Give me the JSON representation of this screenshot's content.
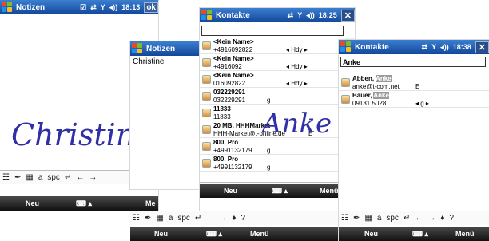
{
  "notes": {
    "title": "Notizen",
    "status": "18:13",
    "ok": "ok",
    "signature": "Christine",
    "kb": [
      "☷",
      "✒",
      "▦",
      "a",
      "spc",
      "↵",
      "←",
      "→"
    ],
    "softkeys": {
      "left": "Neu",
      "right": "Me"
    }
  },
  "notes_text": {
    "title": "Notizen",
    "text": "Christine"
  },
  "contacts": {
    "title": "Kontakte",
    "status": "18:25",
    "close": "✕",
    "search_value": "",
    "handwriting": "Anke",
    "rows": [
      {
        "name": "<Kein Name>",
        "detail": "+4916092822",
        "tag": "◂ Hdy ▸"
      },
      {
        "name": "<Kein Name>",
        "detail": "+4916092",
        "tag": "◂ Hdy ▸"
      },
      {
        "name": "<Kein Name>",
        "detail": "016092822",
        "tag": "◂ Hdy ▸"
      },
      {
        "name": "032229291",
        "detail": "032229291",
        "tag": "g"
      },
      {
        "name": "11833",
        "detail": "11833",
        "tag": ""
      },
      {
        "name": "20 MB, HHHMarket",
        "detail": "HHH-Market@t-online.de",
        "tag": "E"
      },
      {
        "name": "800, Pro",
        "detail": "+4991132179",
        "tag": "g"
      },
      {
        "name": "800, Pro",
        "detail": "+4991132179",
        "tag": "g"
      }
    ],
    "kb": [
      "☷",
      "✒",
      "▦",
      "a",
      "spc",
      "↵",
      "←",
      "→",
      "♦",
      "?"
    ],
    "softkeys": {
      "left": "Neu",
      "right": "Menü"
    }
  },
  "contacts2": {
    "title": "Kontakte",
    "status": "18:38",
    "close": "✕",
    "search_value": "Anke",
    "rows": [
      {
        "name_pre": "Abben, ",
        "name_hl": "Anke",
        "detail": "anke@t-com.net",
        "tag": "E"
      },
      {
        "name_pre": "Bauer, ",
        "name_hl": "Anke",
        "detail": "09131 5028",
        "tag": "◂ g ▸"
      }
    ],
    "kb": [
      "☷",
      "✒",
      "▦",
      "a",
      "spc",
      "↵",
      "←",
      "→",
      "♦",
      "?"
    ],
    "softkeys": {
      "left": "Neu",
      "right": "Menü"
    }
  },
  "front_kb": {
    "kb": [
      "☷",
      "✒",
      "▦",
      "a",
      "spc",
      "↵",
      "←",
      "→",
      "♦",
      "?"
    ],
    "softkeys": {
      "left": "Neu",
      "right": "Menü"
    }
  }
}
